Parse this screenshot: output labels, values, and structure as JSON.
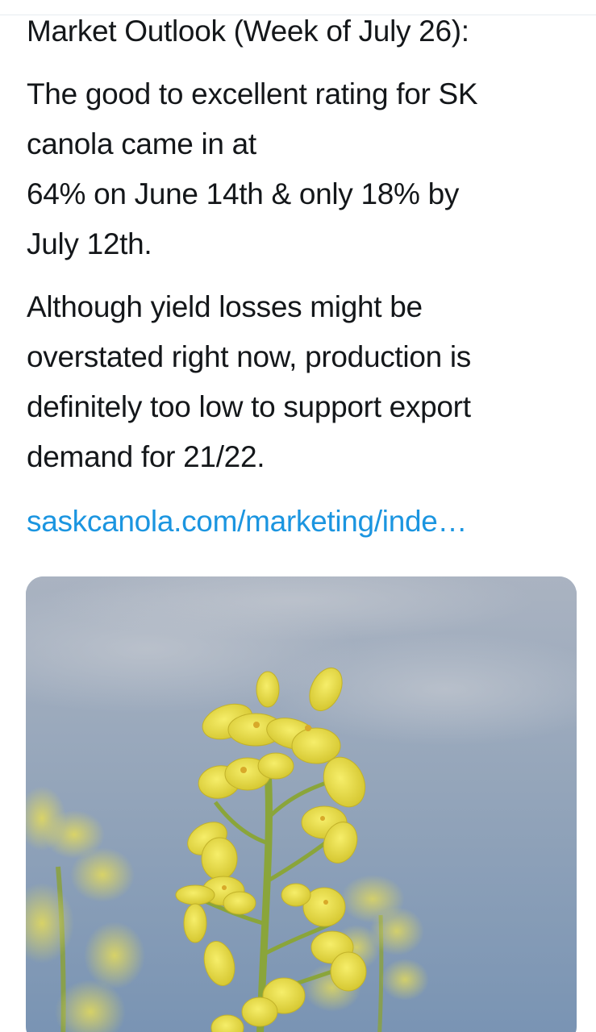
{
  "tweet": {
    "heading": "Market Outlook (Week of July 26):",
    "paragraph1_lines": [
      "The good to excellent rating for SK",
      "canola came in at",
      "64% on June 14th & only 18% by",
      "July 12th."
    ],
    "paragraph2_lines": [
      "Although yield losses might be",
      "overstated right now, production is",
      "definitely too low to support export",
      "demand for 21/22."
    ],
    "link_text": "saskcanola.com/marketing/inde…"
  },
  "media": {
    "alt": "canola flower photo",
    "colors": {
      "sky_top": "#a7b1c0",
      "sky_bottom": "#7f98b6",
      "petal": "#ece24a",
      "petal_shadow": "#c9b92a",
      "stem": "#8aa33a"
    }
  },
  "colors": {
    "text": "#14171a",
    "link": "#1b95e0",
    "background": "#ffffff"
  }
}
